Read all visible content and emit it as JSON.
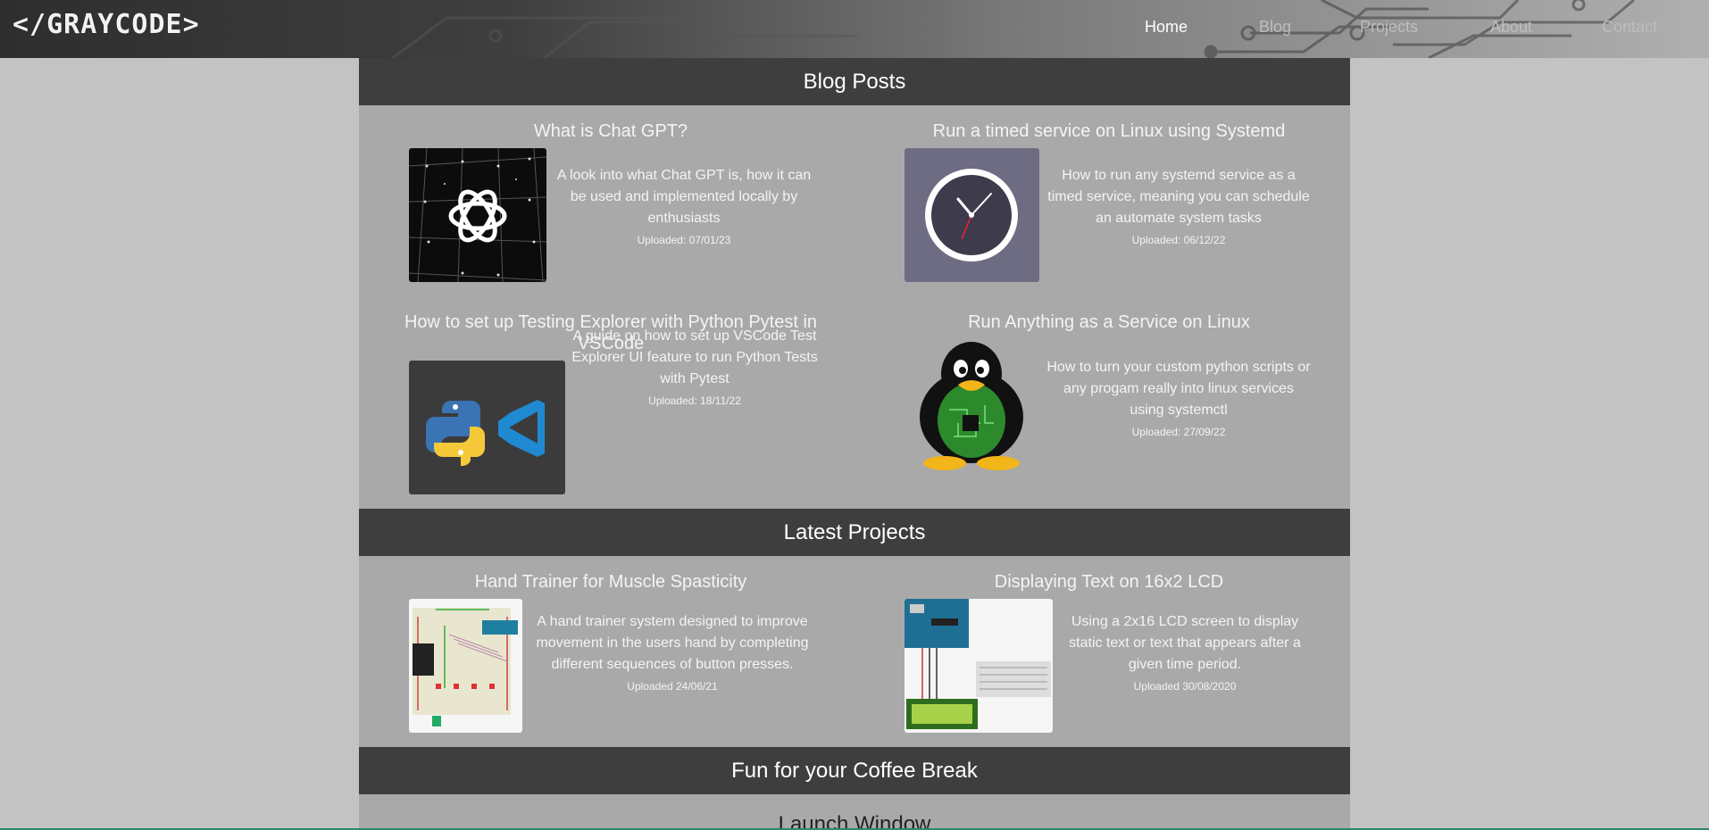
{
  "header": {
    "logo": "</GRAYCODE>",
    "nav": [
      {
        "label": "Home",
        "active": true
      },
      {
        "label": "Blog",
        "active": false
      },
      {
        "label": "Projects",
        "active": false
      },
      {
        "label": "About",
        "active": false
      },
      {
        "label": "Contact",
        "active": false
      }
    ]
  },
  "blog": {
    "heading": "Blog Posts",
    "posts": [
      {
        "title": "What is Chat GPT?",
        "description": "A look into what Chat GPT is, how it can be used and implemented locally by enthusiasts",
        "date": "Uploaded: 07/01/23",
        "icon": "chatgpt-logo-icon"
      },
      {
        "title": "Run a timed service on Linux using Systemd",
        "description": "How to run any systemd service as a timed service, meaning you can schedule an automate system tasks",
        "date": "Uploaded: 06/12/22",
        "icon": "clock-icon"
      },
      {
        "title": "How to set up Testing Explorer with Python Pytest in VSCode",
        "description": "A guide on how to set up VSCode Test Explorer UI feature to run Python Tests with Pytest",
        "date": "Uploaded: 18/11/22",
        "icon": "python-vscode-icon"
      },
      {
        "title": "Run Anything as a Service on Linux",
        "description": "How to turn your custom python scripts or any progam really into linux services using systemctl",
        "date": "Uploaded: 27/09/22",
        "icon": "tux-penguin-icon"
      }
    ]
  },
  "projects": {
    "heading": "Latest Projects",
    "items": [
      {
        "title": "Hand Trainer for Muscle Spasticity",
        "description": "A hand trainer system designed to improve movement in the users hand by completing different sequences of button presses.",
        "date": "Uploaded 24/06/21",
        "icon": "breadboard-circuit-icon"
      },
      {
        "title": "Displaying Text on 16x2 LCD",
        "description": "Using a 2x16 LCD screen to display static text or text that appears after a given time period.",
        "date": "Uploaded 30/08/2020",
        "icon": "arduino-lcd-icon"
      }
    ]
  },
  "coffee": {
    "heading": "Fun for your Coffee Break",
    "first_item": "Launch Window"
  },
  "colors": {
    "page_bg": "#c3c3c3",
    "column_bg": "#a9a9a9",
    "section_header_bg": "#3e3e3e",
    "text": "#f4f4f4"
  }
}
